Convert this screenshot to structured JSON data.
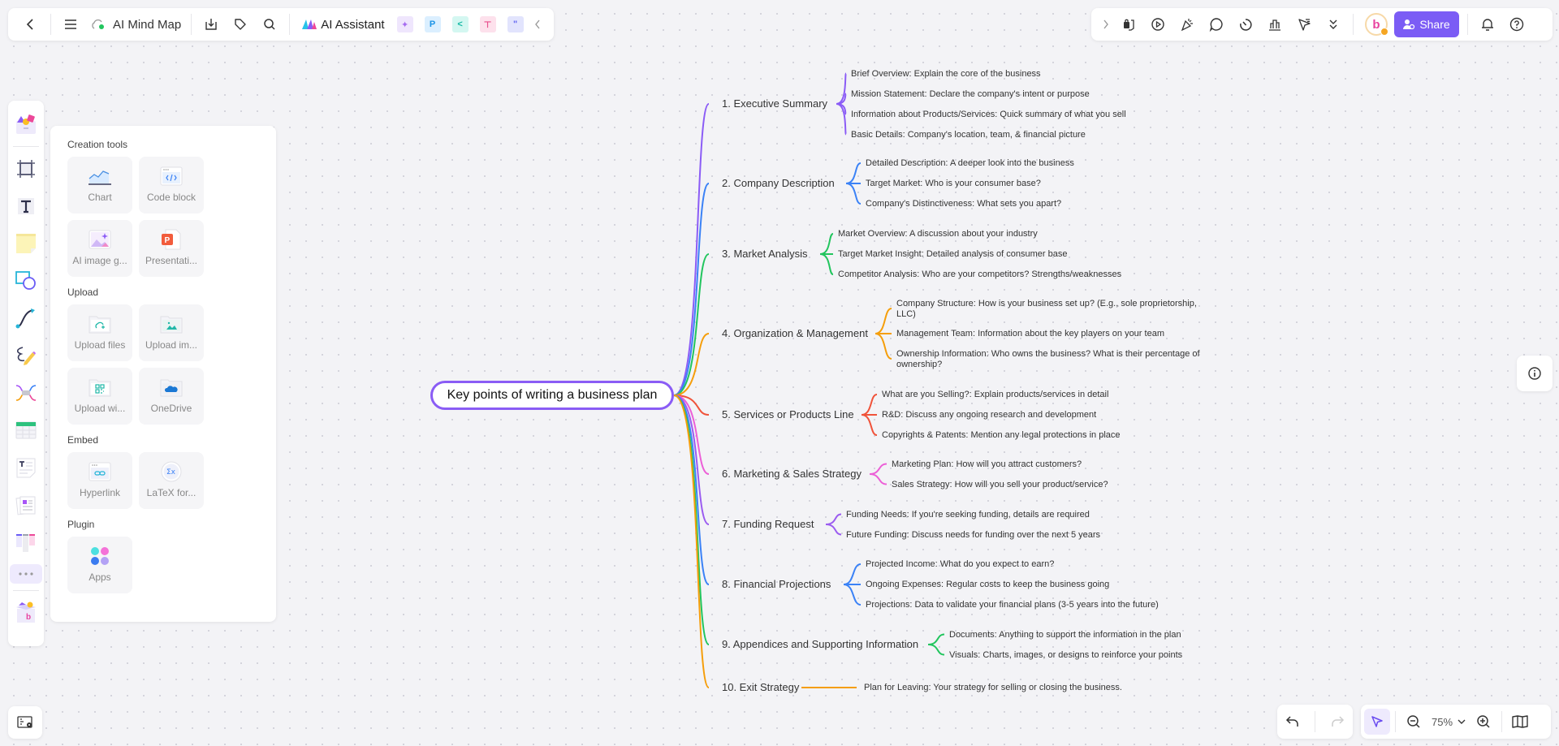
{
  "toolbar_left": {
    "doc_title": "AI Mind Map",
    "ai_assistant_label": "AI Assistant",
    "icons": [
      "back-icon",
      "menu-icon",
      "cloud-sync-icon",
      "download-icon",
      "tag-icon",
      "search-icon"
    ],
    "mini_apps": [
      {
        "name": "ai-image-app-icon",
        "glyph": "✦",
        "bg": "#efe6fd",
        "fg": "#a66cf0"
      },
      {
        "name": "presentation-app-icon",
        "glyph": "P",
        "bg": "#dbefff",
        "fg": "#1a93e6"
      },
      {
        "name": "mindmap-app-icon",
        "glyph": "<",
        "bg": "#d4f7f1",
        "fg": "#12b8a3"
      },
      {
        "name": "flowchart-app-icon",
        "glyph": "⊤",
        "bg": "#fde1ec",
        "fg": "#e8508e"
      },
      {
        "name": "chat-app-icon",
        "glyph": "\"",
        "bg": "#e2e4fd",
        "fg": "#6366f1"
      }
    ]
  },
  "toolbar_right": {
    "share_label": "Share",
    "avatar_letter": "b"
  },
  "zoom": {
    "level": "75%"
  },
  "creation_panel": {
    "sections": [
      {
        "title": "Creation tools",
        "items": [
          "Chart",
          "Code block",
          "AI image g...",
          "Presentati..."
        ]
      },
      {
        "title": "Upload",
        "items": [
          "Upload files",
          "Upload im...",
          "Upload wi...",
          "OneDrive"
        ]
      },
      {
        "title": "Embed",
        "items": [
          "Hyperlink",
          "LaTeX for..."
        ]
      },
      {
        "title": "Plugin",
        "items": [
          "Apps"
        ]
      }
    ]
  },
  "mindmap": {
    "root": "Key points of writing a business plan",
    "branches": [
      {
        "label": "1. Executive Summary",
        "color": "#8b5cf6",
        "children": [
          "Brief Overview: Explain the core of the business",
          "Mission Statement: Declare the company's intent or purpose",
          "Information about Products/Services: Quick summary of what you sell",
          "Basic Details: Company's location, team, & financial picture"
        ]
      },
      {
        "label": "2. Company Description",
        "color": "#3b82f6",
        "children": [
          "Detailed Description: A deeper look into the business",
          "Target Market: Who is your consumer base?",
          "Company's Distinctiveness: What sets you apart?"
        ]
      },
      {
        "label": "3. Market Analysis",
        "color": "#22c55e",
        "children": [
          "Market Overview: A discussion about your industry",
          "Target Market Insight: Detailed analysis of consumer base",
          "Competitor Analysis: Who are your competitors? Strengths/weaknesses"
        ]
      },
      {
        "label": "4. Organization & Management",
        "color": "#f59e0b",
        "children": [
          "Company Structure: How is your business set up? (E.g., sole proprietorship, LLC)",
          "Management Team: Information about the key players on your team",
          "Ownership Information: Who owns the business? What is their percentage of ownership?"
        ]
      },
      {
        "label": "5. Services or Products Line",
        "color": "#f0533a",
        "children": [
          "What are you Selling?: Explain products/services in detail",
          "R&D: Discuss any ongoing research and development",
          "Copyrights & Patents: Mention any legal protections in place"
        ]
      },
      {
        "label": "6. Marketing & Sales Strategy",
        "color": "#ec5fd7",
        "children": [
          "Marketing Plan: How will you attract customers?",
          "Sales Strategy: How will you sell your product/service?"
        ]
      },
      {
        "label": "7. Funding Request",
        "color": "#9b5cf0",
        "children": [
          "Funding Needs: If you're seeking funding, details are required",
          "Future Funding: Discuss needs for funding over the next 5 years"
        ]
      },
      {
        "label": "8. Financial Projections",
        "color": "#3b82f6",
        "children": [
          "Projected Income: What do you expect to earn?",
          "Ongoing Expenses: Regular costs to keep the business going",
          "Projections: Data to validate your financial plans (3-5 years into the future)"
        ]
      },
      {
        "label": "9. Appendices and Supporting Information",
        "color": "#22c55e",
        "children": [
          "Documents: Anything to support the information in the plan",
          "Visuals: Charts, images, or designs to reinforce your points"
        ]
      },
      {
        "label": "10. Exit Strategy",
        "color": "#f59e0b",
        "children": [
          "Plan for Leaving: Your strategy for selling or closing the business."
        ]
      }
    ]
  }
}
